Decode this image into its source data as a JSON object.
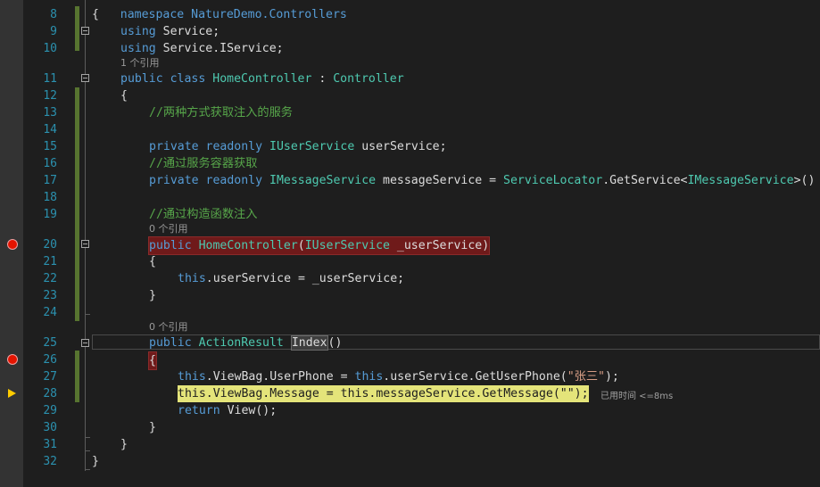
{
  "editor": {
    "top_partial_line": "namespace NatureDemo.Controllers",
    "line_numbers": [
      "8",
      "9",
      "10",
      "11",
      "12",
      "13",
      "14",
      "15",
      "16",
      "17",
      "18",
      "19",
      "20",
      "21",
      "22",
      "23",
      "24",
      "25",
      "26",
      "27",
      "28",
      "29",
      "30",
      "31",
      "32"
    ],
    "codelens": {
      "class_refs": "1 个引用",
      "ctor_refs": "0 个引用",
      "action_refs": "0 个引用"
    },
    "code": {
      "l8": "{",
      "l9_kw": "using",
      "l9_ns": " Service;",
      "l10_kw": "using",
      "l10_ns": " Service.IService;",
      "l11_kw1": "public",
      "l11_kw2": "class",
      "l11_name": "HomeController",
      "l11_colon": " : ",
      "l11_base": "Controller",
      "l12": "{",
      "l13": "//两种方式获取注入的服务",
      "l15_kw1": "private",
      "l15_kw2": "readonly",
      "l15_type": "IUserService",
      "l15_rest": " userService;",
      "l16": "//通过服务容器获取",
      "l17_kw1": "private",
      "l17_kw2": "readonly",
      "l17_type": "IMessageService",
      "l17_mid": " messageService = ",
      "l17_locator": "ServiceLocator",
      "l17_call": ".GetService<",
      "l17_generic": "IMessageService",
      "l17_end": ">()",
      "l19": "//通过构造函数注入",
      "l20_kw": "public",
      "l20_name": "HomeController",
      "l20_paren": "(",
      "l20_type": "IUserService",
      "l20_rest": " _userService)",
      "l21": "{",
      "l22_this": "this",
      "l22_rest": ".userService = _userService;",
      "l23": "}",
      "l25_kw": "public",
      "l25_type": "ActionResult",
      "l25_name": "Index",
      "l25_paren": "()",
      "l26": "{",
      "l27_this": "this",
      "l27_mid": ".ViewBag.UserPhone = ",
      "l27_this2": "this",
      "l27_call": ".userService.GetUserPhone(",
      "l27_str": "\"张三\"",
      "l27_end": ");",
      "l28_this": "this",
      "l28_mid": ".ViewBag.Message = ",
      "l28_this2": "this",
      "l28_call": ".messageService.GetMessage(",
      "l28_str": "\"\"",
      "l28_end": ");",
      "l28_timing": "已用时间 <=8ms",
      "l29_kw": "return",
      "l29_rest": " View();",
      "l30": "}",
      "l31": "}",
      "l32": "}"
    },
    "colors": {
      "background": "#1e1e1e",
      "keyword": "#569cd6",
      "type": "#4ec9b0",
      "comment": "#57a64a",
      "string": "#d69d85",
      "line_number": "#2b91af",
      "breakpoint": "#e51400",
      "current_statement": "#e4e47a"
    }
  }
}
